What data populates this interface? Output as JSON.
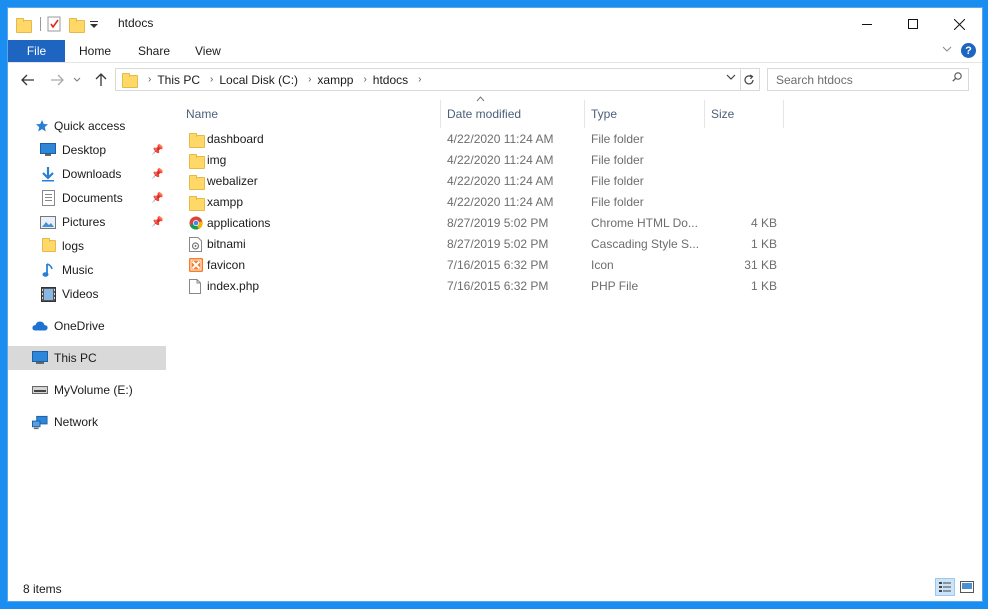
{
  "window": {
    "title": "htdocs",
    "minimize_icon": "minimize-icon",
    "maximize_icon": "maximize-icon",
    "close_icon": "close-icon"
  },
  "ribbon": {
    "tabs": [
      {
        "label": "File"
      },
      {
        "label": "Home"
      },
      {
        "label": "Share"
      },
      {
        "label": "View"
      }
    ],
    "help_label": "?"
  },
  "address": {
    "crumbs": [
      "This PC",
      "Local Disk (C:)",
      "xampp",
      "htdocs"
    ],
    "search_placeholder": "Search htdocs"
  },
  "sidebar": {
    "items": [
      {
        "label": "Quick access",
        "icon": "star-icon"
      },
      {
        "label": "Desktop",
        "icon": "desktop-icon",
        "pinned": true
      },
      {
        "label": "Downloads",
        "icon": "download-icon",
        "pinned": true
      },
      {
        "label": "Documents",
        "icon": "documents-icon",
        "pinned": true
      },
      {
        "label": "Pictures",
        "icon": "pictures-icon",
        "pinned": true
      },
      {
        "label": "logs",
        "icon": "folder-icon"
      },
      {
        "label": "Music",
        "icon": "music-icon"
      },
      {
        "label": "Videos",
        "icon": "videos-icon"
      },
      {
        "label": "OneDrive",
        "icon": "cloud-icon"
      },
      {
        "label": "This PC",
        "icon": "computer-icon",
        "selected": true
      },
      {
        "label": "MyVolume (E:)",
        "icon": "drive-icon"
      },
      {
        "label": "Network",
        "icon": "network-icon"
      }
    ]
  },
  "columns": {
    "name": "Name",
    "date": "Date modified",
    "type": "Type",
    "size": "Size"
  },
  "files": [
    {
      "name": "dashboard",
      "date": "4/22/2020 11:24 AM",
      "type": "File folder",
      "size": "",
      "icon": "folder-icon"
    },
    {
      "name": "img",
      "date": "4/22/2020 11:24 AM",
      "type": "File folder",
      "size": "",
      "icon": "folder-icon"
    },
    {
      "name": "webalizer",
      "date": "4/22/2020 11:24 AM",
      "type": "File folder",
      "size": "",
      "icon": "folder-icon"
    },
    {
      "name": "xampp",
      "date": "4/22/2020 11:24 AM",
      "type": "File folder",
      "size": "",
      "icon": "folder-icon"
    },
    {
      "name": "applications",
      "date": "8/27/2019 5:02 PM",
      "type": "Chrome HTML Do...",
      "size": "4 KB",
      "icon": "chrome-icon"
    },
    {
      "name": "bitnami",
      "date": "8/27/2019 5:02 PM",
      "type": "Cascading Style S...",
      "size": "1 KB",
      "icon": "css-file-icon"
    },
    {
      "name": "favicon",
      "date": "7/16/2015 6:32 PM",
      "type": "Icon",
      "size": "31 KB",
      "icon": "xampp-icon"
    },
    {
      "name": "index.php",
      "date": "7/16/2015 6:32 PM",
      "type": "PHP File",
      "size": "1 KB",
      "icon": "file-icon"
    }
  ],
  "status": {
    "item_count": "8 items"
  },
  "colors": {
    "accent": "#1d65c1",
    "desktop_bg": "#1a8ef0",
    "folder": "#ffd867",
    "selection": "#d9d9d9"
  }
}
